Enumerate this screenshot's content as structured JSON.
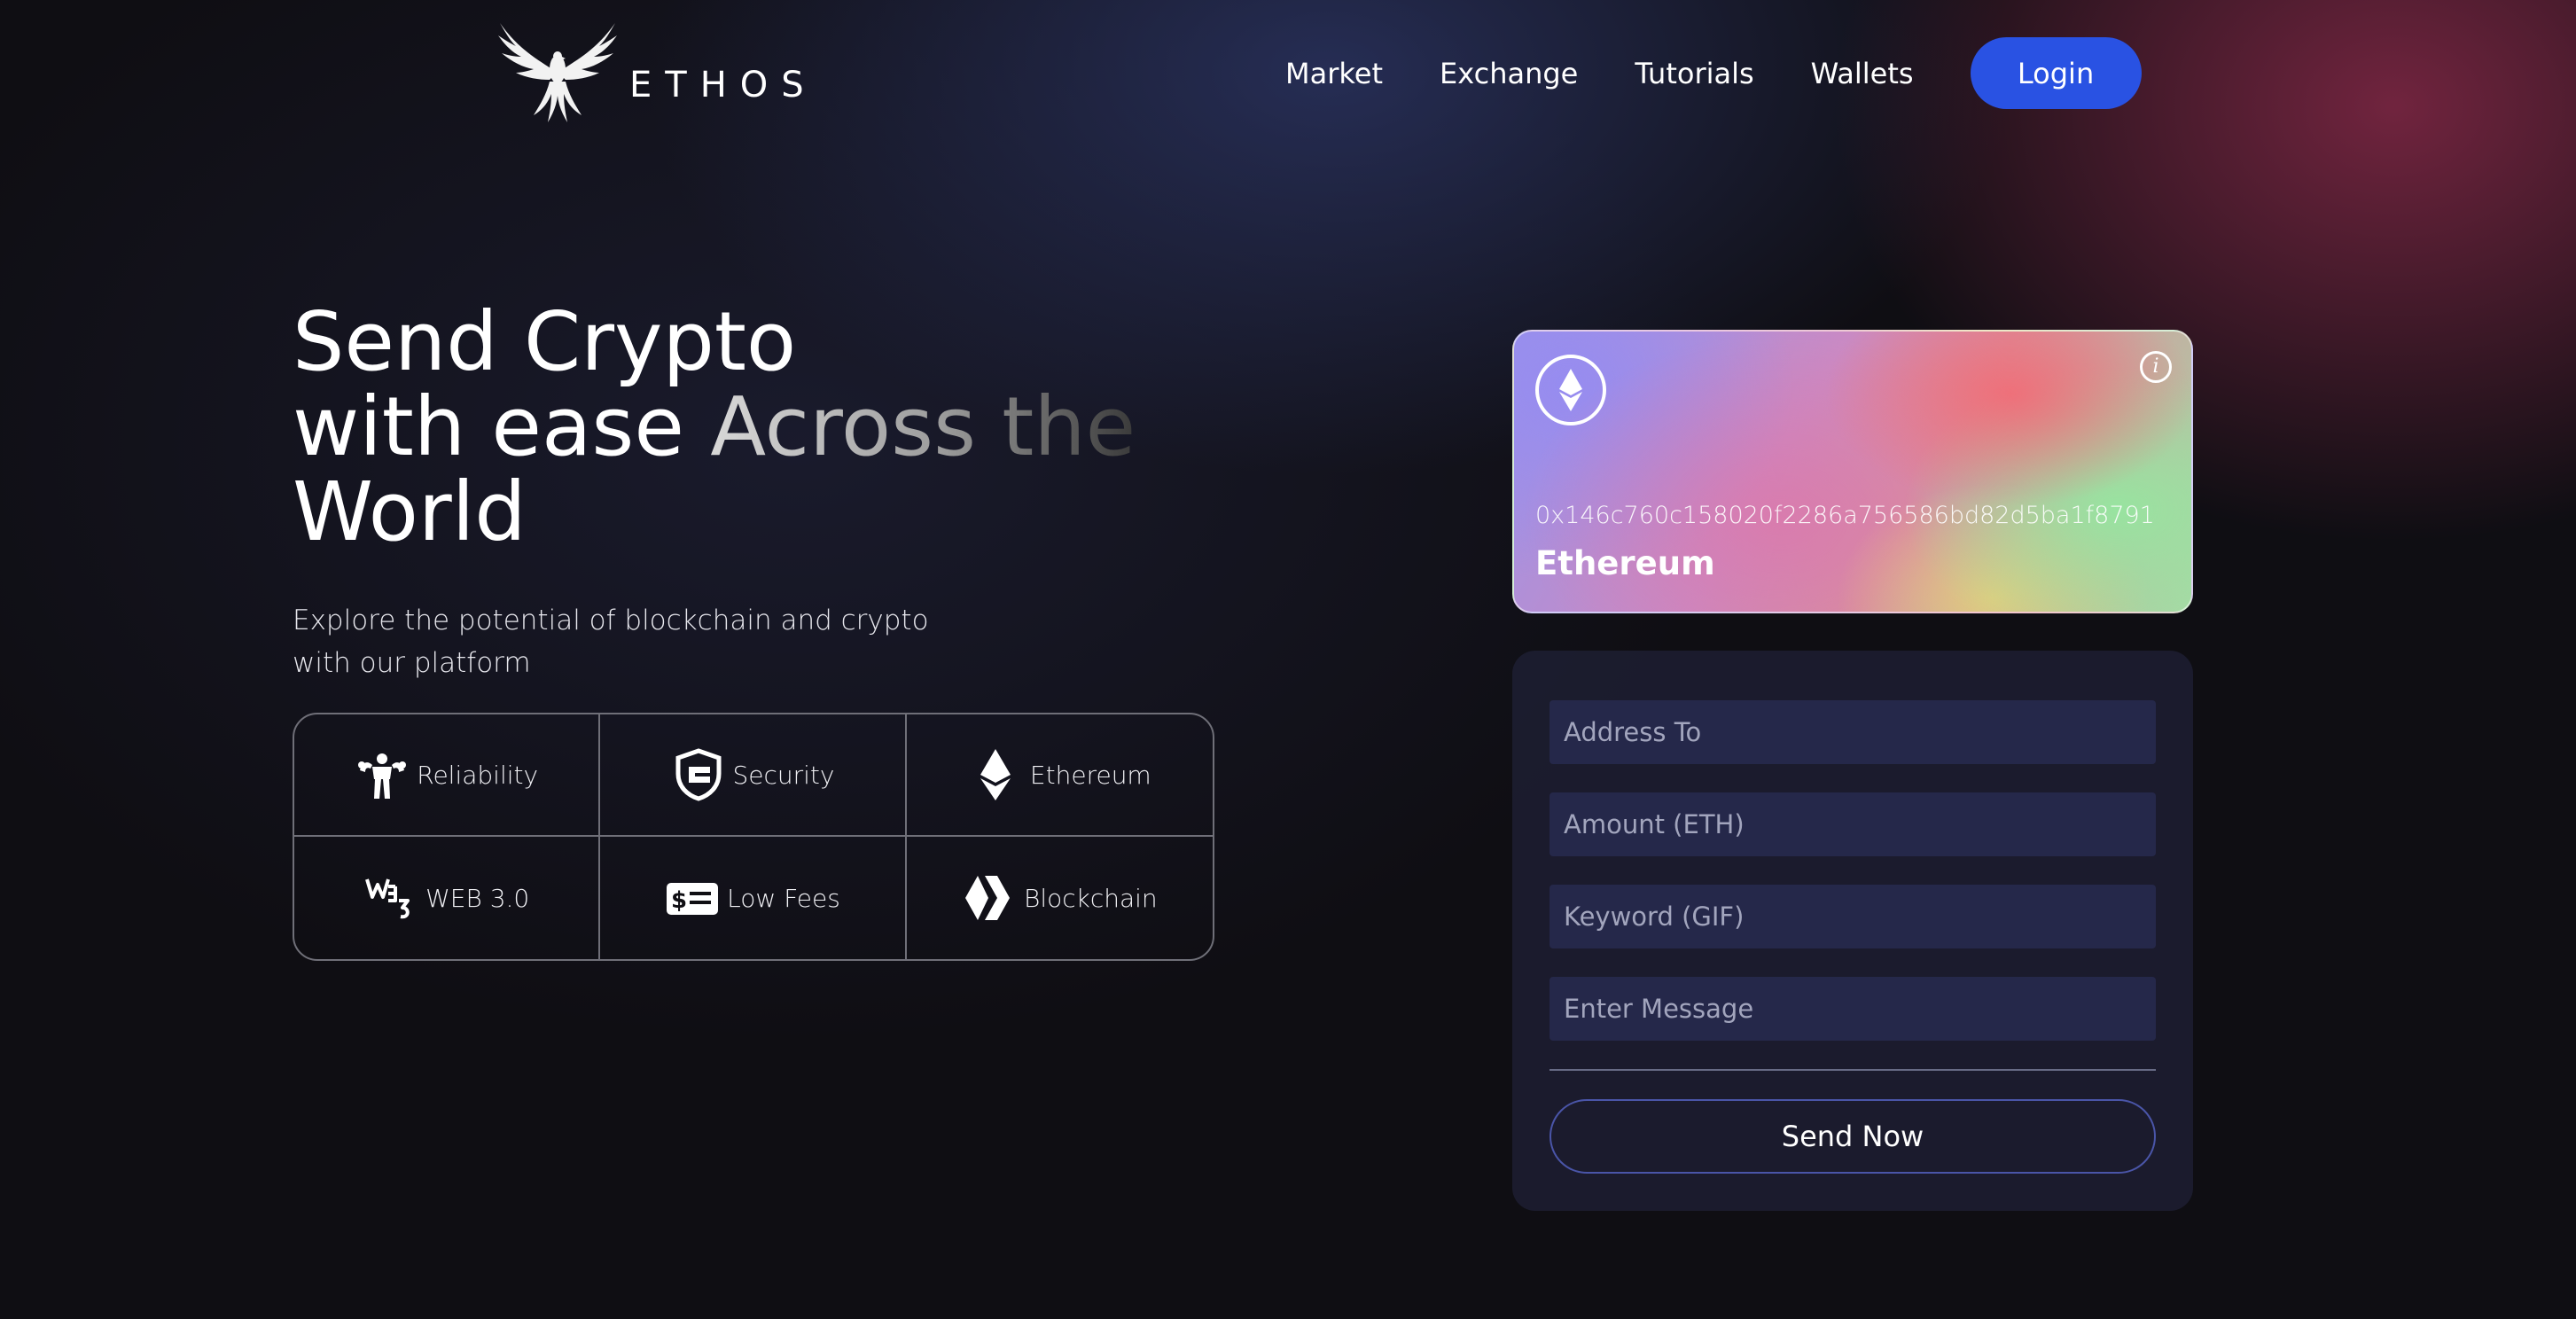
{
  "brand": {
    "name": "ETHOS",
    "logo_icon": "phoenix-icon"
  },
  "nav": {
    "links": [
      "Market",
      "Exchange",
      "Tutorials",
      "Wallets"
    ],
    "login_label": "Login",
    "login_color": "#2952e3"
  },
  "hero": {
    "title_line1": "Send Crypto",
    "title_line2_plain": "with ease ",
    "title_line2_fade": "Across the",
    "title_line3": "World",
    "subtitle": "Explore the potential of blockchain and crypto with our platform"
  },
  "features": [
    {
      "label": "Reliability",
      "icon": "strongman-icon"
    },
    {
      "label": "Security",
      "icon": "shield-icon"
    },
    {
      "label": "Ethereum",
      "icon": "ethereum-icon"
    },
    {
      "label": "WEB 3.0",
      "icon": "web3-icon"
    },
    {
      "label": "Low Fees",
      "icon": "money-bill-icon"
    },
    {
      "label": "Blockchain",
      "icon": "hive-icon"
    }
  ],
  "card": {
    "address": "0x146c760c158020f2286a756586bd82d5ba1f8791",
    "network": "Ethereum",
    "badge_icon": "ethereum-icon",
    "info_icon": "info-icon"
  },
  "form": {
    "address_placeholder": "Address To",
    "amount_placeholder": "Amount (ETH)",
    "keyword_placeholder": "Keyword (GIF)",
    "message_placeholder": "Enter Message",
    "send_label": "Send Now"
  }
}
